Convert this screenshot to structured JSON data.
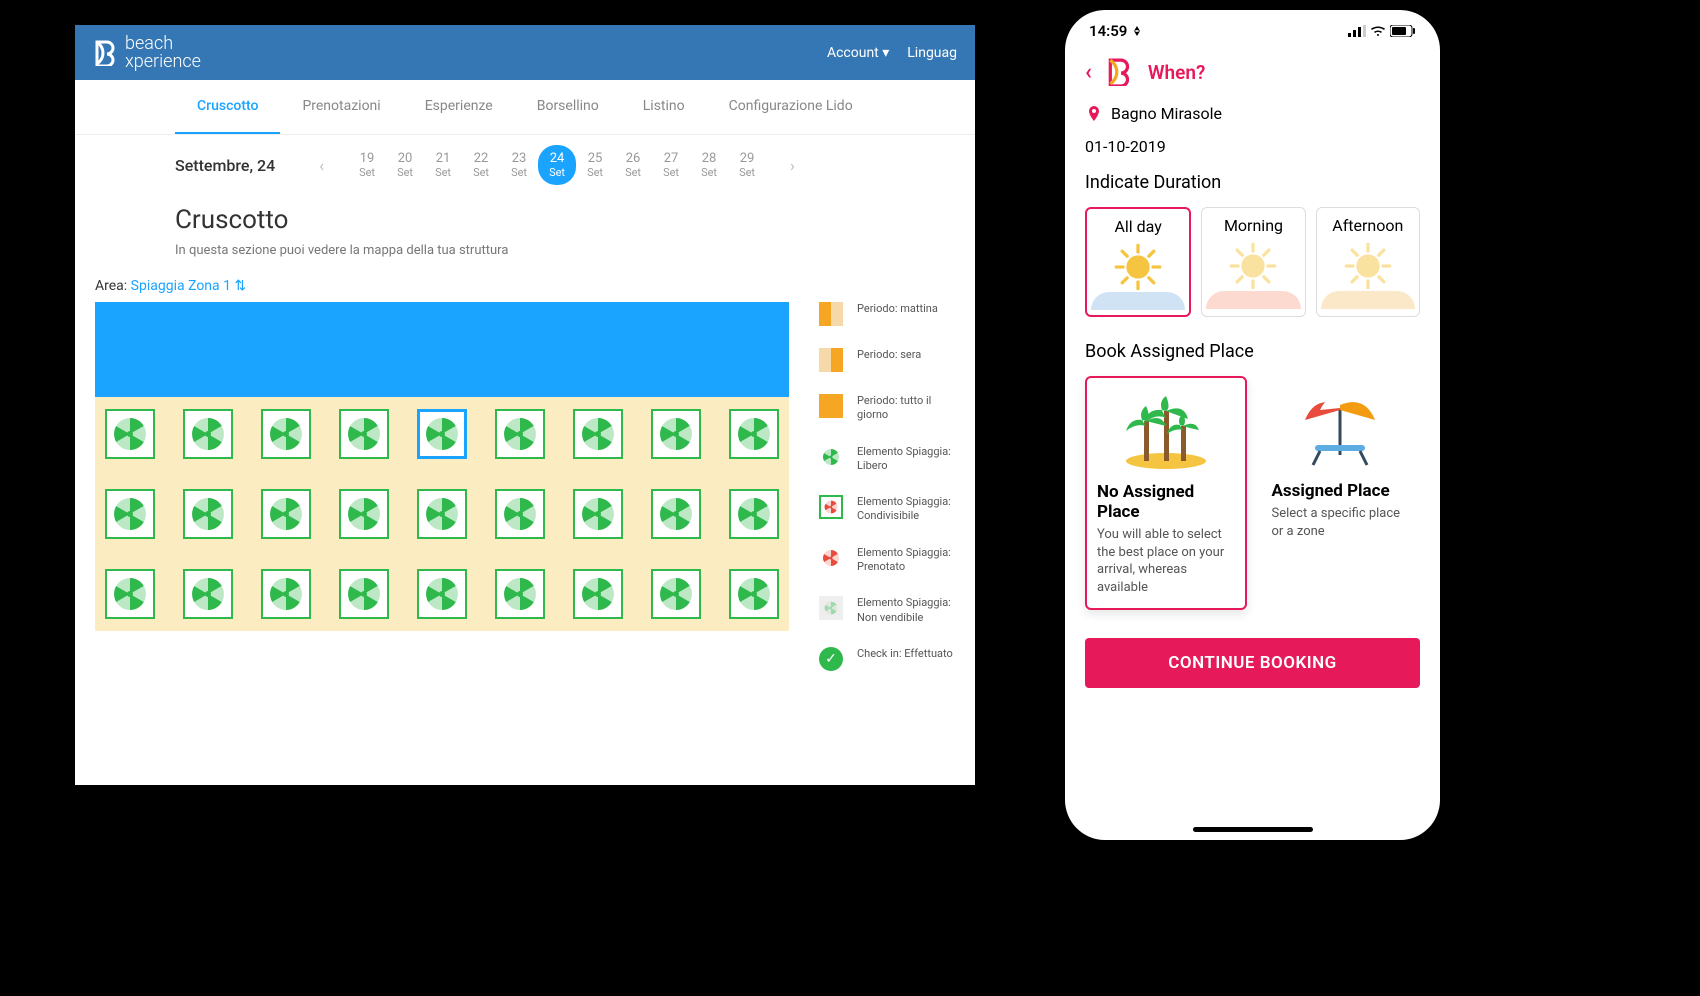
{
  "desktop": {
    "brand": "beach\nxperience",
    "menu": {
      "account": "Account",
      "language": "Linguag"
    },
    "tabs": [
      "Cruscotto",
      "Prenotazioni",
      "Esperienze",
      "Borsellino",
      "Listino",
      "Configurazione Lido"
    ],
    "active_tab": 0,
    "current_date_label": "Settembre, 24",
    "dates": [
      {
        "num": "19",
        "mon": "Set"
      },
      {
        "num": "20",
        "mon": "Set"
      },
      {
        "num": "21",
        "mon": "Set"
      },
      {
        "num": "22",
        "mon": "Set"
      },
      {
        "num": "23",
        "mon": "Set"
      },
      {
        "num": "24",
        "mon": "Set"
      },
      {
        "num": "25",
        "mon": "Set"
      },
      {
        "num": "26",
        "mon": "Set"
      },
      {
        "num": "27",
        "mon": "Set"
      },
      {
        "num": "28",
        "mon": "Set"
      },
      {
        "num": "29",
        "mon": "Set"
      }
    ],
    "selected_date_index": 5,
    "section_title": "Cruscotto",
    "section_subtitle": "In questa sezione puoi vedere la mappa della tua struttura",
    "area_label": "Area:",
    "area_value": "Spiaggia Zona 1",
    "legend": [
      {
        "swatch": "sw-half-l",
        "text": "Periodo: mattina"
      },
      {
        "swatch": "sw-half-r",
        "text": "Periodo: sera"
      },
      {
        "swatch": "sw-full",
        "text": "Periodo: tutto il giorno"
      },
      {
        "swatch": "umb-free",
        "text": "Elemento Spiaggia: Libero"
      },
      {
        "swatch": "umb-share",
        "text": "Elemento Spiaggia: Condivisibile"
      },
      {
        "swatch": "umb-booked",
        "text": "Elemento Spiaggia: Prenotato"
      },
      {
        "swatch": "umb-ns",
        "text": "Elemento Spiaggia: Non vendibile"
      },
      {
        "swatch": "check",
        "text": "Check in: Effettuato"
      }
    ],
    "grid": {
      "rows": 3,
      "cols": 9,
      "selected": [
        0,
        4
      ]
    }
  },
  "mobile": {
    "time": "14:59",
    "title": "When?",
    "location": "Bagno Mirasole",
    "date": "01-10-2019",
    "duration_label": "Indicate Duration",
    "durations": [
      "All day",
      "Morning",
      "Afternoon"
    ],
    "selected_duration": 0,
    "place_label": "Book Assigned Place",
    "places": [
      {
        "title": "No Assigned Place",
        "desc": "You will able to select the best place on your arrival, whereas available"
      },
      {
        "title": "Assigned Place",
        "desc": "Select a specific place or a zone"
      }
    ],
    "selected_place": 0,
    "cta": "CONTINUE BOOKING"
  }
}
